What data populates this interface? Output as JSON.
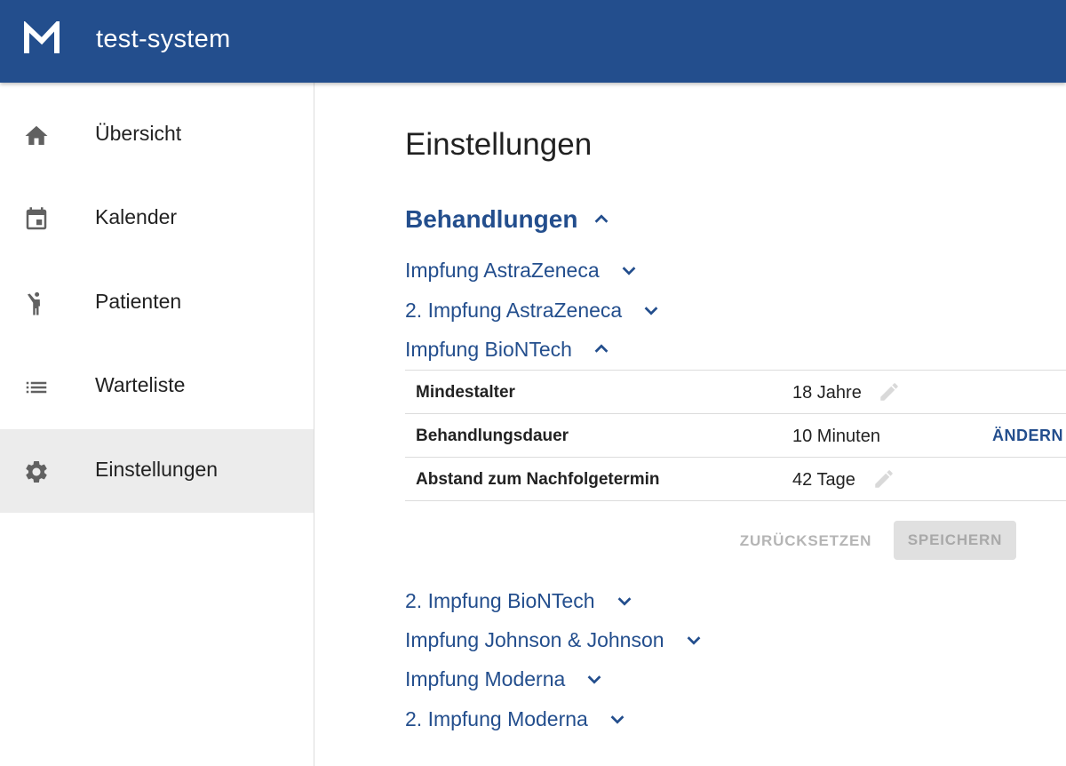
{
  "app": {
    "title": "test-system",
    "logo_icon": "m-logo",
    "brand_color": "#234e8d"
  },
  "sidebar": {
    "items": [
      {
        "label": "Übersicht",
        "icon": "home-icon"
      },
      {
        "label": "Kalender",
        "icon": "calendar-icon"
      },
      {
        "label": "Patienten",
        "icon": "person-icon"
      },
      {
        "label": "Warteliste",
        "icon": "list-icon"
      },
      {
        "label": "Einstellungen",
        "icon": "gear-icon",
        "active": true
      }
    ]
  },
  "main": {
    "title": "Einstellungen",
    "section": {
      "title": "Behandlungen",
      "expanded": true
    },
    "treatments": [
      {
        "label": "Impfung AstraZeneca",
        "expanded": false
      },
      {
        "label": "2. Impfung AstraZeneca",
        "expanded": false
      },
      {
        "label": "Impfung BioNTech",
        "expanded": true
      },
      {
        "label": "2. Impfung BioNTech",
        "expanded": false
      },
      {
        "label": "Impfung Johnson & Johnson",
        "expanded": false
      },
      {
        "label": "Impfung Moderna",
        "expanded": false
      },
      {
        "label": "2. Impfung Moderna",
        "expanded": false
      }
    ],
    "settings": [
      {
        "key": "Mindestalter",
        "value": "18 Jahre"
      },
      {
        "key": "Behandlungsdauer",
        "value": "10 Minuten",
        "action": "ÄNDERN"
      },
      {
        "key": "Abstand zum Nachfolgetermin",
        "value": "42 Tage"
      }
    ],
    "buttons": {
      "reset": "ZURÜCKSETZEN",
      "save": "SPEICHERN"
    }
  }
}
